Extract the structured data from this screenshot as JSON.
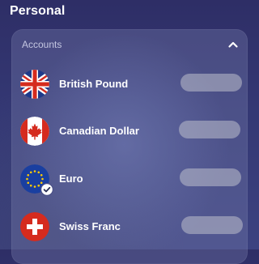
{
  "section": {
    "title": "Personal"
  },
  "accounts_card": {
    "label": "Accounts",
    "collapse_icon": "chevron-up-icon",
    "items": [
      {
        "name": "British Pound",
        "flag": "uk-flag-icon",
        "selected": false
      },
      {
        "name": "Canadian Dollar",
        "flag": "canada-flag-icon",
        "selected": false
      },
      {
        "name": "Euro",
        "flag": "eu-flag-icon",
        "selected": true
      },
      {
        "name": "Swiss Franc",
        "flag": "swiss-flag-icon",
        "selected": false
      }
    ]
  },
  "colors": {
    "background_top": "#2e2e66",
    "background_bottom": "#3c4280",
    "card": "#5d6294",
    "uk_blue": "#1e3a8a",
    "red": "#d52b1e",
    "eu_blue": "#1a3fa0",
    "eu_star": "#ffcc00"
  }
}
